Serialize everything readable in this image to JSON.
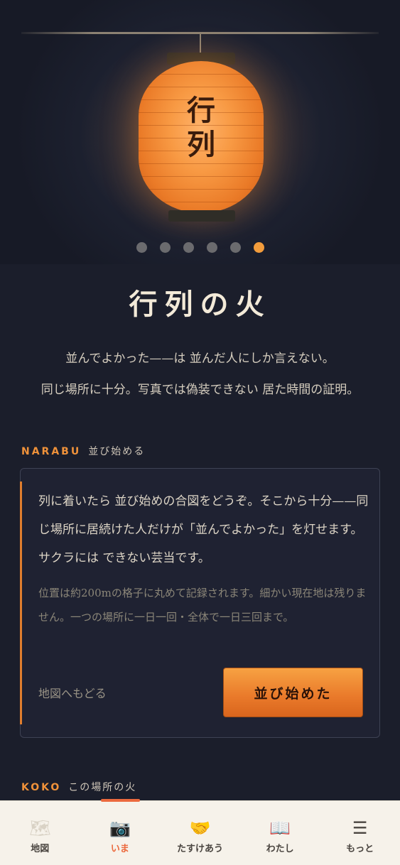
{
  "hero": {
    "lantern_text": "行\n列",
    "carousel": {
      "count": 6,
      "active_index": 5
    }
  },
  "title": "行列の火",
  "lead": {
    "line1": "並んでよかった——は 並んだ人にしか言えない。",
    "line2": "同じ場所に十分。写真では偽装できない 居た時間の証明。"
  },
  "narabu": {
    "label_en": "NARABU",
    "label_jp": "並び始める",
    "body": "列に着いたら 並び始めの合図をどうぞ。そこから十分——同じ場所に居続けた人だけが「並んでよかった」を灯せます。サクラには できない芸当です。",
    "note": "位置は約200mの格子に丸めて記録されます。細かい現在地は残りません。一つの場所に一日一回・全体で一日三回まで。",
    "back_link": "地図へもどる",
    "start_button": "並び始めた"
  },
  "koko": {
    "label_en": "KOKO",
    "label_jp": "この場所の火"
  },
  "tabs": [
    {
      "label": "地図",
      "icon": "world-map-icon",
      "glyph": "🗺"
    },
    {
      "label": "いま",
      "icon": "camera-icon",
      "glyph": "📷",
      "active": true
    },
    {
      "label": "たすけあう",
      "icon": "handshake-icon",
      "glyph": "🤝"
    },
    {
      "label": "わたし",
      "icon": "open-book-icon",
      "glyph": "📖"
    },
    {
      "label": "もっと",
      "icon": "menu-icon",
      "glyph": "☰"
    }
  ],
  "colors": {
    "accent": "#f0923a",
    "active_tab": "#ec6a3e",
    "background": "#1b1e2b"
  }
}
